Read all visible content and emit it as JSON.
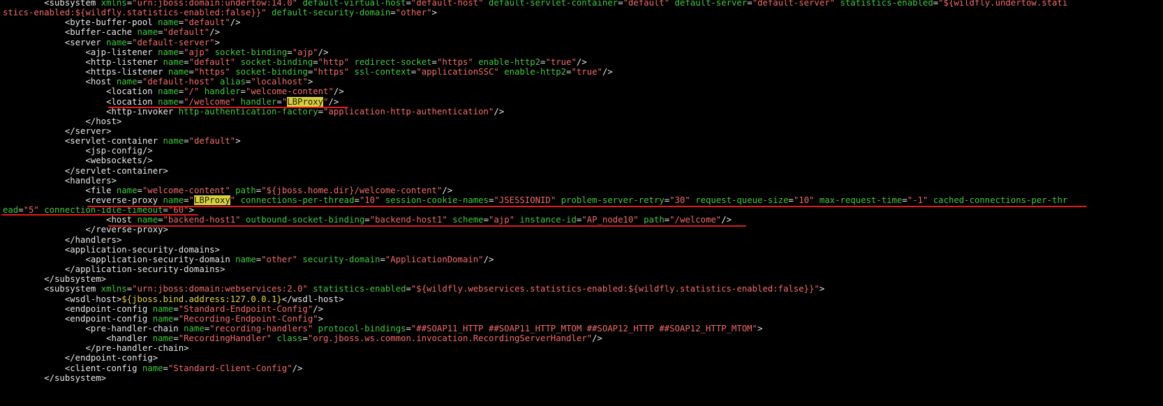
{
  "colors": {
    "background": "#000000",
    "tag": "#e8e8e8",
    "attribute": "#3ec93e",
    "value": "#f26a6a",
    "expression": "#e4d33c",
    "highlight": "#d8d23a",
    "annotation_underline": "#e11b1b"
  },
  "lines": [
    [
      [
        "tag",
        "        <subsystem "
      ],
      [
        "attr",
        "xmlns"
      ],
      [
        "tag",
        "="
      ],
      [
        "val",
        "\"urn:jboss:domain:undertow:14.0\""
      ],
      [
        "tag",
        " "
      ],
      [
        "attr",
        "default-virtual-host"
      ],
      [
        "tag",
        "="
      ],
      [
        "val",
        "\"default-host\""
      ],
      [
        "tag",
        " "
      ],
      [
        "attr",
        "default-servlet-container"
      ],
      [
        "tag",
        "="
      ],
      [
        "val",
        "\"default\""
      ],
      [
        "tag",
        " "
      ],
      [
        "attr",
        "default-server"
      ],
      [
        "tag",
        "="
      ],
      [
        "val",
        "\"default-server\""
      ],
      [
        "tag",
        " "
      ],
      [
        "attr",
        "statistics-enabled"
      ],
      [
        "tag",
        "="
      ],
      [
        "val",
        "\"${wildfly.undertow.stati"
      ]
    ],
    [
      [
        "val",
        "stics-enabled:${wildfly.statistics-enabled:false}}\""
      ],
      [
        "tag",
        " "
      ],
      [
        "attr",
        "default-security-domain"
      ],
      [
        "tag",
        "="
      ],
      [
        "val",
        "\"other\""
      ],
      [
        "tag",
        ">"
      ]
    ],
    [
      [
        "tag",
        "            <byte-buffer-pool "
      ],
      [
        "attr",
        "name"
      ],
      [
        "tag",
        "="
      ],
      [
        "val",
        "\"default\""
      ],
      [
        "tag",
        "/>"
      ]
    ],
    [
      [
        "tag",
        "            <buffer-cache "
      ],
      [
        "attr",
        "name"
      ],
      [
        "tag",
        "="
      ],
      [
        "val",
        "\"default\""
      ],
      [
        "tag",
        "/>"
      ]
    ],
    [
      [
        "tag",
        "            <server "
      ],
      [
        "attr",
        "name"
      ],
      [
        "tag",
        "="
      ],
      [
        "val",
        "\"default-server\""
      ],
      [
        "tag",
        ">"
      ]
    ],
    [
      [
        "tag",
        "                <ajp-listener "
      ],
      [
        "attr",
        "name"
      ],
      [
        "tag",
        "="
      ],
      [
        "val",
        "\"ajp\""
      ],
      [
        "tag",
        " "
      ],
      [
        "attr",
        "socket-binding"
      ],
      [
        "tag",
        "="
      ],
      [
        "val",
        "\"ajp\""
      ],
      [
        "tag",
        "/>"
      ]
    ],
    [
      [
        "tag",
        "                <http-listener "
      ],
      [
        "attr",
        "name"
      ],
      [
        "tag",
        "="
      ],
      [
        "val",
        "\"default\""
      ],
      [
        "tag",
        " "
      ],
      [
        "attr",
        "socket-binding"
      ],
      [
        "tag",
        "="
      ],
      [
        "val",
        "\"http\""
      ],
      [
        "tag",
        " "
      ],
      [
        "attr",
        "redirect-socket"
      ],
      [
        "tag",
        "="
      ],
      [
        "val",
        "\"https\""
      ],
      [
        "tag",
        " "
      ],
      [
        "attr",
        "enable-http2"
      ],
      [
        "tag",
        "="
      ],
      [
        "val",
        "\"true\""
      ],
      [
        "tag",
        "/>"
      ]
    ],
    [
      [
        "tag",
        "                <https-listener "
      ],
      [
        "attr",
        "name"
      ],
      [
        "tag",
        "="
      ],
      [
        "val",
        "\"https\""
      ],
      [
        "tag",
        " "
      ],
      [
        "attr",
        "socket-binding"
      ],
      [
        "tag",
        "="
      ],
      [
        "val",
        "\"https\""
      ],
      [
        "tag",
        " "
      ],
      [
        "attr",
        "ssl-context"
      ],
      [
        "tag",
        "="
      ],
      [
        "val",
        "\"applicationSSC\""
      ],
      [
        "tag",
        " "
      ],
      [
        "attr",
        "enable-http2"
      ],
      [
        "tag",
        "="
      ],
      [
        "val",
        "\"true\""
      ],
      [
        "tag",
        "/>"
      ]
    ],
    [
      [
        "tag",
        "                <host "
      ],
      [
        "attr",
        "name"
      ],
      [
        "tag",
        "="
      ],
      [
        "val",
        "\"default-host\""
      ],
      [
        "tag",
        " "
      ],
      [
        "attr",
        "alias"
      ],
      [
        "tag",
        "="
      ],
      [
        "val",
        "\"localhost\""
      ],
      [
        "tag",
        ">"
      ]
    ],
    [
      [
        "tag",
        "                    <location "
      ],
      [
        "attr",
        "name"
      ],
      [
        "tag",
        "="
      ],
      [
        "val",
        "\"/\""
      ],
      [
        "tag",
        " "
      ],
      [
        "attr",
        "handler"
      ],
      [
        "tag",
        "="
      ],
      [
        "val",
        "\"welcome-content\""
      ],
      [
        "tag",
        "/>"
      ]
    ],
    [
      [
        "tag",
        "                    <location "
      ],
      [
        "attr",
        "name"
      ],
      [
        "tag",
        "="
      ],
      [
        "val",
        "\"/welcome\""
      ],
      [
        "tag",
        " "
      ],
      [
        "attr",
        "handler"
      ],
      [
        "tag",
        "="
      ],
      [
        "val",
        "\""
      ],
      [
        "hl",
        "LBProxy"
      ],
      [
        "val",
        "\""
      ],
      [
        "tag",
        "/>"
      ]
    ],
    [
      [
        "tag",
        "                    <http-invoker "
      ],
      [
        "attr",
        "http-authentication-factory"
      ],
      [
        "tag",
        "="
      ],
      [
        "val",
        "\"application-http-authentication\""
      ],
      [
        "tag",
        "/>"
      ]
    ],
    [
      [
        "tag",
        "                </host>"
      ]
    ],
    [
      [
        "tag",
        "            </server>"
      ]
    ],
    [
      [
        "tag",
        "            <servlet-container "
      ],
      [
        "attr",
        "name"
      ],
      [
        "tag",
        "="
      ],
      [
        "val",
        "\"default\""
      ],
      [
        "tag",
        ">"
      ]
    ],
    [
      [
        "tag",
        "                <jsp-config/>"
      ]
    ],
    [
      [
        "tag",
        "                <websockets/>"
      ]
    ],
    [
      [
        "tag",
        "            </servlet-container>"
      ]
    ],
    [
      [
        "tag",
        "            <handlers>"
      ]
    ],
    [
      [
        "tag",
        "                <file "
      ],
      [
        "attr",
        "name"
      ],
      [
        "tag",
        "="
      ],
      [
        "val",
        "\"welcome-content\""
      ],
      [
        "tag",
        " "
      ],
      [
        "attr",
        "path"
      ],
      [
        "tag",
        "="
      ],
      [
        "val",
        "\"${jboss.home.dir}/welcome-content\""
      ],
      [
        "tag",
        "/>"
      ]
    ],
    [
      [
        "tag",
        "                <reverse-proxy "
      ],
      [
        "attr",
        "name"
      ],
      [
        "tag",
        "="
      ],
      [
        "val",
        "\""
      ],
      [
        "hl",
        "LBProxy"
      ],
      [
        "val",
        "\""
      ],
      [
        "tag",
        " "
      ],
      [
        "attr",
        "connections-per-thread"
      ],
      [
        "tag",
        "="
      ],
      [
        "val",
        "\"10\""
      ],
      [
        "tag",
        " "
      ],
      [
        "attr",
        "session-cookie-names"
      ],
      [
        "tag",
        "="
      ],
      [
        "val",
        "\"JSESSIONID\""
      ],
      [
        "tag",
        " "
      ],
      [
        "attr",
        "problem-server-retry"
      ],
      [
        "tag",
        "="
      ],
      [
        "val",
        "\"30\""
      ],
      [
        "tag",
        " "
      ],
      [
        "attr",
        "request-queue-size"
      ],
      [
        "tag",
        "="
      ],
      [
        "val",
        "\"10\""
      ],
      [
        "tag",
        " "
      ],
      [
        "attr",
        "max-request-time"
      ],
      [
        "tag",
        "="
      ],
      [
        "val",
        "\"-1\""
      ],
      [
        "tag",
        " "
      ],
      [
        "attr",
        "cached-connections-per-thr"
      ]
    ],
    [
      [
        "attr",
        "ead"
      ],
      [
        "tag",
        "="
      ],
      [
        "val",
        "\"5\""
      ],
      [
        "tag",
        " "
      ],
      [
        "attr",
        "connection-idle-timeout"
      ],
      [
        "tag",
        "="
      ],
      [
        "val",
        "\"60\""
      ],
      [
        "tag",
        ">"
      ]
    ],
    [
      [
        "tag",
        "                    <host "
      ],
      [
        "attr",
        "name"
      ],
      [
        "tag",
        "="
      ],
      [
        "val",
        "\"backend-host1\""
      ],
      [
        "tag",
        " "
      ],
      [
        "attr",
        "outbound-socket-binding"
      ],
      [
        "tag",
        "="
      ],
      [
        "val",
        "\"backend-host1\""
      ],
      [
        "tag",
        " "
      ],
      [
        "attr",
        "scheme"
      ],
      [
        "tag",
        "="
      ],
      [
        "val",
        "\"ajp\""
      ],
      [
        "tag",
        " "
      ],
      [
        "attr",
        "instance-id"
      ],
      [
        "tag",
        "="
      ],
      [
        "val",
        "\"AP_node10\""
      ],
      [
        "tag",
        " "
      ],
      [
        "attr",
        "path"
      ],
      [
        "tag",
        "="
      ],
      [
        "val",
        "\"/welcome\""
      ],
      [
        "tag",
        "/>"
      ]
    ],
    [
      [
        "tag",
        "                </reverse-proxy>"
      ]
    ],
    [
      [
        "tag",
        "            </handlers>"
      ]
    ],
    [
      [
        "tag",
        "            <application-security-domains>"
      ]
    ],
    [
      [
        "tag",
        "                <application-security-domain "
      ],
      [
        "attr",
        "name"
      ],
      [
        "tag",
        "="
      ],
      [
        "val",
        "\"other\""
      ],
      [
        "tag",
        " "
      ],
      [
        "attr",
        "security-domain"
      ],
      [
        "tag",
        "="
      ],
      [
        "val",
        "\"ApplicationDomain\""
      ],
      [
        "tag",
        "/>"
      ]
    ],
    [
      [
        "tag",
        "            </application-security-domains>"
      ]
    ],
    [
      [
        "tag",
        "        </subsystem>"
      ]
    ],
    [
      [
        "tag",
        "        <subsystem "
      ],
      [
        "attr",
        "xmlns"
      ],
      [
        "tag",
        "="
      ],
      [
        "val",
        "\"urn:jboss:domain:webservices:2.0\""
      ],
      [
        "tag",
        " "
      ],
      [
        "attr",
        "statistics-enabled"
      ],
      [
        "tag",
        "="
      ],
      [
        "val",
        "\"${wildfly.webservices.statistics-enabled:${wildfly.statistics-enabled:false}}\""
      ],
      [
        "tag",
        ">"
      ]
    ],
    [
      [
        "tag",
        "            <wsdl-host>"
      ],
      [
        "expr",
        "${jboss.bind.address:127.0.0.1}"
      ],
      [
        "tag",
        "</wsdl-host>"
      ]
    ],
    [
      [
        "tag",
        "            <endpoint-config "
      ],
      [
        "attr",
        "name"
      ],
      [
        "tag",
        "="
      ],
      [
        "val",
        "\"Standard-Endpoint-Config\""
      ],
      [
        "tag",
        "/>"
      ]
    ],
    [
      [
        "tag",
        "            <endpoint-config "
      ],
      [
        "attr",
        "name"
      ],
      [
        "tag",
        "="
      ],
      [
        "val",
        "\"Recording-Endpoint-Config\""
      ],
      [
        "tag",
        ">"
      ]
    ],
    [
      [
        "tag",
        "                <pre-handler-chain "
      ],
      [
        "attr",
        "name"
      ],
      [
        "tag",
        "="
      ],
      [
        "val",
        "\"recording-handlers\""
      ],
      [
        "tag",
        " "
      ],
      [
        "attr",
        "protocol-bindings"
      ],
      [
        "tag",
        "="
      ],
      [
        "val",
        "\"##SOAP11_HTTP ##SOAP11_HTTP_MTOM ##SOAP12_HTTP ##SOAP12_HTTP_MTOM\""
      ],
      [
        "tag",
        ">"
      ]
    ],
    [
      [
        "tag",
        "                    <handler "
      ],
      [
        "attr",
        "name"
      ],
      [
        "tag",
        "="
      ],
      [
        "val",
        "\"RecordingHandler\""
      ],
      [
        "tag",
        " "
      ],
      [
        "attr",
        "class"
      ],
      [
        "tag",
        "="
      ],
      [
        "val",
        "\"org.jboss.ws.common.invocation.RecordingServerHandler\""
      ],
      [
        "tag",
        "/>"
      ]
    ],
    [
      [
        "tag",
        "                </pre-handler-chain>"
      ]
    ],
    [
      [
        "tag",
        "            </endpoint-config>"
      ]
    ],
    [
      [
        "tag",
        "            <client-config "
      ],
      [
        "attr",
        "name"
      ],
      [
        "tag",
        "="
      ],
      [
        "val",
        "\"Standard-Client-Config\""
      ],
      [
        "tag",
        "/>"
      ]
    ],
    [
      [
        "tag",
        "        </subsystem>"
      ]
    ]
  ]
}
